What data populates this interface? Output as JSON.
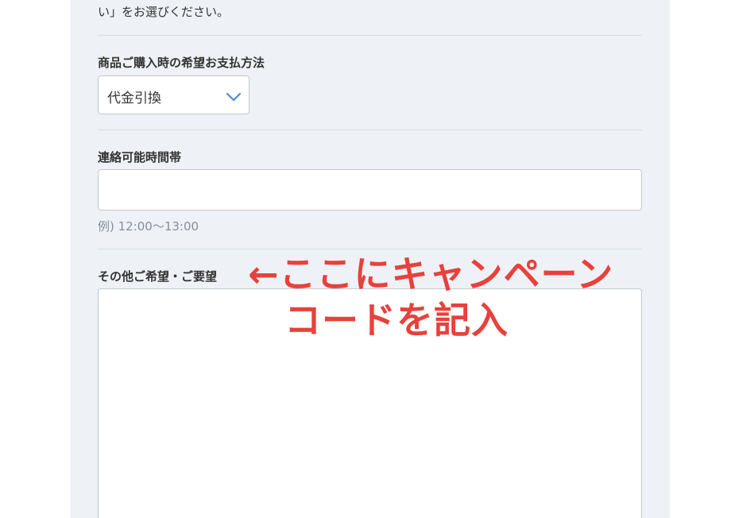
{
  "intro": {
    "text": "い」をお選びください。"
  },
  "payment": {
    "label": "商品ご購入時の希望お支払方法",
    "selected_value": "代金引換",
    "chevron_icon": "chevron-down-icon",
    "accent_color": "#4a8fd8"
  },
  "contact_time": {
    "label": "連絡可能時間帯",
    "value": "",
    "hint": "例) 12:00〜13:00"
  },
  "requests": {
    "label": "その他ご希望・ご要望",
    "value": ""
  },
  "annotation": {
    "line1": "←ここにキャンペーン",
    "line2": "コードを記入",
    "color": "#e8413c"
  }
}
